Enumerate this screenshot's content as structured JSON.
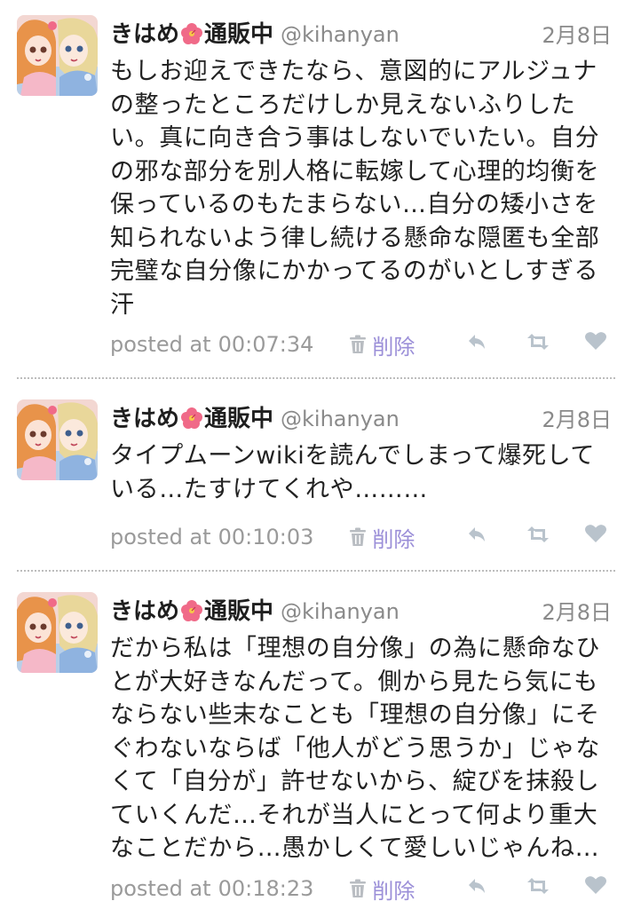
{
  "colors": {
    "text": "#222222",
    "muted": "#8a8a8a",
    "delete_link": "#9b8fd8",
    "action_icon": "#b9c3cc",
    "divider": "#bdbdbd"
  },
  "icons": {
    "trash": "trash-icon",
    "reply": "reply-icon",
    "retweet": "retweet-icon",
    "like": "heart-icon",
    "name_emoji": "hibiscus-icon"
  },
  "tweets": [
    {
      "name_before_icon": "きはめ",
      "name_after_icon": "通販中",
      "handle": "@kihanyan",
      "date": "2月8日",
      "lines": [
        "もしお迎えできたなら、意図的にアルジュナ",
        "の整ったところだけしか見えないふりした",
        "い。真に向き合う事はしないでいたい。自分",
        "の邪な部分を別人格に転嫁して心理的均衡を",
        "保っているのもたまらない…自分の矮小さを",
        "知られないよう律し続ける懸命な隠匿も全部",
        "完璧な自分像にかかってるのがいとしすぎる",
        "汗"
      ],
      "posted_label": "posted at",
      "time": "00:07:34",
      "delete_label": "削除"
    },
    {
      "name_before_icon": "きはめ",
      "name_after_icon": "通販中",
      "handle": "@kihanyan",
      "date": "2月8日",
      "lines": [
        "タイプムーンwikiを読んでしまって爆死して",
        "いる…たすけてくれや………"
      ],
      "posted_label": "posted at",
      "time": "00:10:03",
      "delete_label": "削除"
    },
    {
      "name_before_icon": "きはめ",
      "name_after_icon": "通販中",
      "handle": "@kihanyan",
      "date": "2月8日",
      "lines": [
        "だから私は「理想の自分像」の為に懸命なひ",
        "とが大好きなんだって。側から見たら気にも",
        "ならない些末なことも「理想の自分像」にそ",
        "ぐわないならば「他人がどう思うか」じゃな",
        "くて「自分が」許せないから、綻びを抹殺し",
        "ていくんだ…それが当人にとって何より重大",
        "なことだから…愚かしくて愛しいじゃんね…"
      ],
      "posted_label": "posted at",
      "time": "00:18:23",
      "delete_label": "削除"
    }
  ]
}
